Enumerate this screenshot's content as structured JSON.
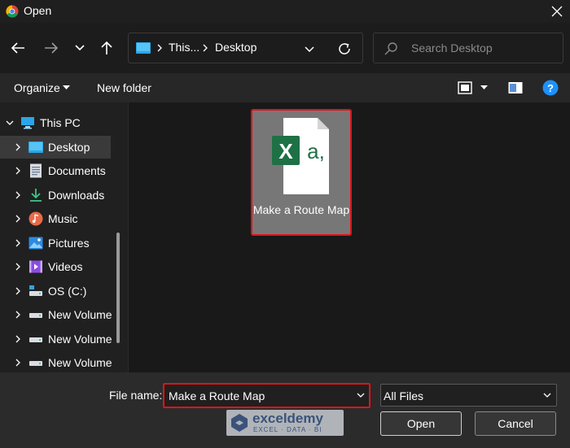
{
  "window": {
    "title": "Open"
  },
  "navigation": {
    "breadcrumb": [
      "This...",
      "Desktop"
    ],
    "search_placeholder": "Search Desktop"
  },
  "commands": {
    "organize": "Organize",
    "new_folder": "New folder"
  },
  "sidebar": {
    "items": [
      {
        "label": "This PC",
        "icon": "pc-icon",
        "expanded": true
      },
      {
        "label": "Desktop",
        "icon": "desktop-folder-icon",
        "selected": true
      },
      {
        "label": "Documents",
        "icon": "documents-icon"
      },
      {
        "label": "Downloads",
        "icon": "downloads-icon"
      },
      {
        "label": "Music",
        "icon": "music-icon"
      },
      {
        "label": "Pictures",
        "icon": "pictures-icon"
      },
      {
        "label": "Videos",
        "icon": "videos-icon"
      },
      {
        "label": "OS (C:)",
        "icon": "drive-icon"
      },
      {
        "label": "New Volume",
        "icon": "drive-icon"
      },
      {
        "label": "New Volume",
        "icon": "drive-icon"
      },
      {
        "label": "New Volume",
        "icon": "drive-icon"
      }
    ]
  },
  "files": [
    {
      "name": "Make a Route Map",
      "icon": "excel-file-icon",
      "selected": true
    }
  ],
  "footer": {
    "file_name_label": "File name:",
    "file_name_value": "Make a Route Map",
    "file_type_value": "All Files",
    "open_label": "Open",
    "cancel_label": "Cancel"
  },
  "watermark": {
    "title": "exceldemy",
    "subtitle": "EXCEL · DATA · BI"
  },
  "colors": {
    "highlight": "#e0131a",
    "excel_green": "#1e7145",
    "accent_blue": "#1e90ff"
  }
}
